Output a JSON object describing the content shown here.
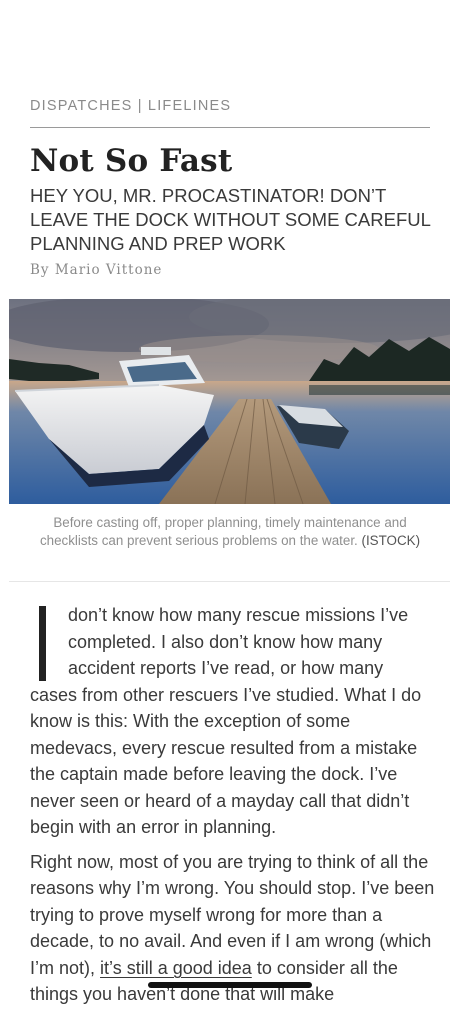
{
  "article": {
    "kicker": "DISPATCHES | LIFELINES",
    "title": "Not So Fast",
    "subtitle": "HEY YOU, MR. PROCASTINATOR! DON’T LEAVE THE DOCK WITHOUT SOME CAREFUL PLANNING AND PREP WORK",
    "byline": "By Mario Vittone"
  },
  "hero": {
    "caption": "Before casting off, proper planning, timely maintenance and checklists can prevent serious problems on the water.",
    "credit": "(ISTOCK)"
  },
  "body": {
    "p1": "don’t know how many rescue missions I’ve completed. I also don’t know how many accident reports I’ve read, or how many cases from other rescuers I’ve studied. What I do know is this: With the exception of some medevacs, every rescue resulted from a mistake the captain made before leaving the dock. I’ve never seen or heard of a mayday call that didn’t begin with an error in planning.",
    "p2_start": "Right now, most of you are trying to think of all the reasons why I’m wrong. You should stop. I’ve been trying to prove myself wrong for more than a decade, to no avail. And even if I am wrong (which I’m not),",
    "p2_link": "it’s still a good idea",
    "p2_end": "to consider all the things you haven’t done that will make"
  },
  "colors": {
    "text": "#3a3a3a",
    "title": "#222222",
    "meta": "#8a8a8a",
    "water": "#3a6fb0",
    "sunset": "#f4c27a"
  }
}
